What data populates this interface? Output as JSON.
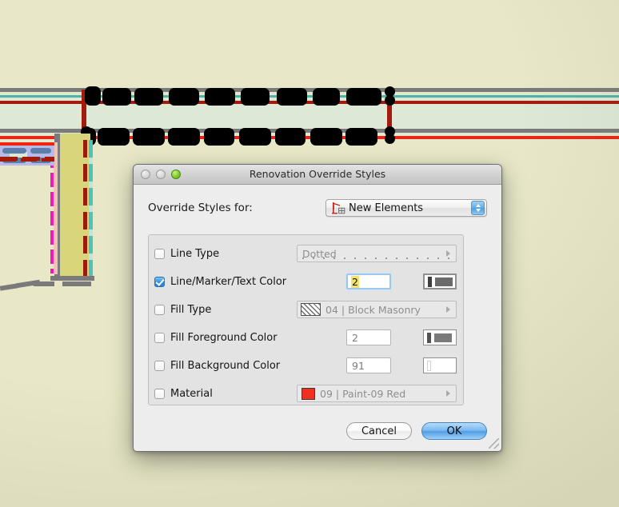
{
  "window": {
    "title": "Renovation Override Styles",
    "traffic_lights": [
      "close-button",
      "minimize-button",
      "zoom-button"
    ]
  },
  "dialog": {
    "override_label": "Override Styles for:",
    "scope_popup": {
      "value": "New Elements",
      "icon": "renovation-new-elements-icon"
    },
    "options": [
      {
        "id": "line-type",
        "label": "Line Type",
        "checked": false,
        "control": "preview-dotted",
        "value": "Dotted"
      },
      {
        "id": "line-marker-text-color",
        "label": "Line/Marker/Text Color",
        "checked": true,
        "control": "pen-number",
        "value": "2",
        "swatch_thin_color": "#3f3f3f",
        "swatch_thick_color": "#6b6b6b",
        "focused": true
      },
      {
        "id": "fill-type",
        "label": "Fill Type",
        "checked": false,
        "control": "fill-pattern",
        "value": "04 | Block Masonry"
      },
      {
        "id": "fill-foreground-color",
        "label": "Fill Foreground Color",
        "checked": false,
        "control": "pen-number",
        "value": "2",
        "swatch_thin_color": "#525252",
        "swatch_thick_color": "#7a7a7a",
        "focused": false
      },
      {
        "id": "fill-background-color",
        "label": "Fill Background Color",
        "checked": false,
        "control": "pen-number",
        "value": "91",
        "swatch_thin_color": "#ffffff",
        "swatch_thick_color": "#ffffff",
        "focused": false
      },
      {
        "id": "material",
        "label": "Material",
        "checked": false,
        "control": "material-swatch",
        "value": "09 | Paint-09 Red",
        "swatch_color": "#f03020"
      }
    ],
    "buttons": {
      "cancel": "Cancel",
      "ok": "OK"
    }
  },
  "canvas": {
    "background_color": "#e8e8c8",
    "corridor_fill": "#dde8d7",
    "line_colors": {
      "gray": "#7a7a7a",
      "teal": "#4fb3a5",
      "dark_red": "#a51b0b",
      "bright_red": "#e8251a",
      "magenta": "#f318b8",
      "olive_room": "#d8d57a",
      "lavender_room": "#b8b9e8",
      "blue_pill": "#5a7fa8",
      "cyan": "#4fc3bb",
      "pink": "#f2c3b2"
    },
    "redactions_top_row": 9,
    "redactions_bottom_row": 9
  }
}
